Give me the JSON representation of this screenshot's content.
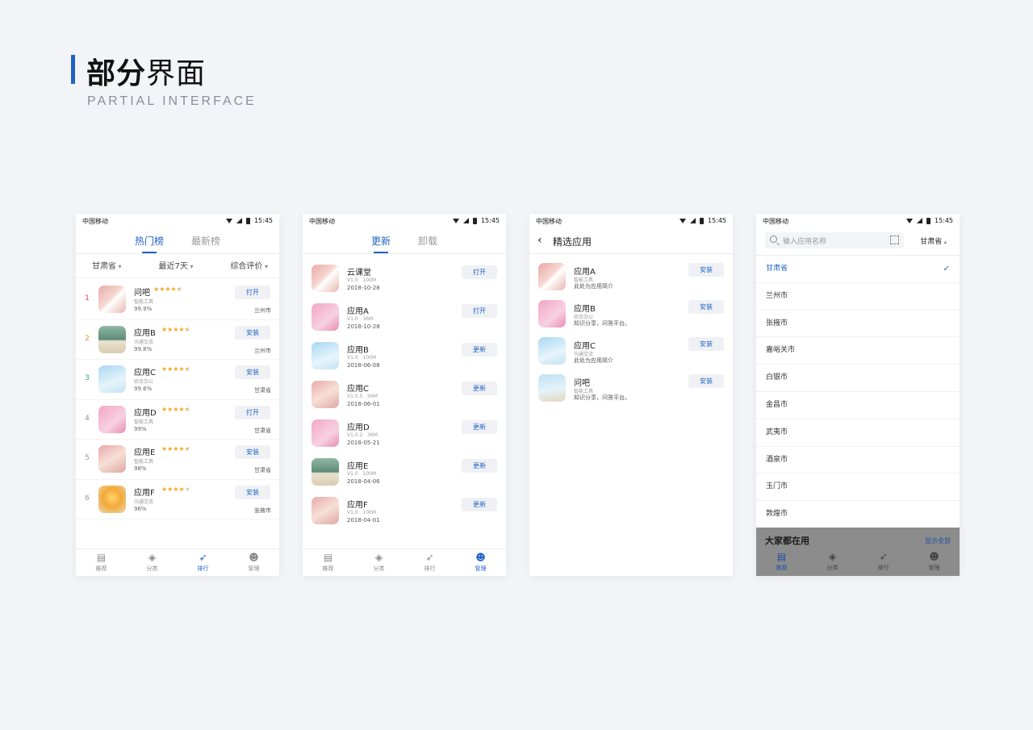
{
  "header": {
    "title_bold": "部分",
    "title_light": "界面",
    "subtitle": "PARTIAL INTERFACE",
    "accent": "#1f63c6"
  },
  "status": {
    "carrier": "中国移动",
    "time": "15:45"
  },
  "nav": [
    {
      "label": "推荐",
      "icon": "book-icon"
    },
    {
      "label": "分类",
      "icon": "layers-icon"
    },
    {
      "label": "排行",
      "icon": "rocket-icon"
    },
    {
      "label": "管理",
      "icon": "user-gear-icon"
    }
  ],
  "screen1": {
    "tabs": [
      "热门榜",
      "最新榜"
    ],
    "filters": [
      "甘肃省",
      "最近7天",
      "综合评价"
    ],
    "rows": [
      {
        "rank": "1",
        "rank_color": "#e0383e",
        "name": "问吧",
        "rating": 4.5,
        "category": "智能工具",
        "percent": "99.9%",
        "location": "兰州市",
        "button": "打开"
      },
      {
        "rank": "2",
        "rank_color": "#f08a24",
        "name": "应用B",
        "rating": 4.5,
        "category": "沟通交流",
        "percent": "99.8%",
        "location": "兰州市",
        "button": "安装"
      },
      {
        "rank": "3",
        "rank_color": "#2ea44f",
        "name": "应用C",
        "rating": 4.5,
        "category": "综合办公",
        "percent": "99.6%",
        "location": "甘肃省",
        "button": "安装"
      },
      {
        "rank": "4",
        "rank_color": "#999999",
        "name": "应用D",
        "rating": 4.5,
        "category": "智能工具",
        "percent": "99%",
        "location": "甘肃省",
        "button": "打开"
      },
      {
        "rank": "5",
        "rank_color": "#999999",
        "name": "应用E",
        "rating": 4.5,
        "category": "智能工具",
        "percent": "98%",
        "location": "甘肃省",
        "button": "安装"
      },
      {
        "rank": "6",
        "rank_color": "#999999",
        "name": "应用F",
        "rating": 4,
        "category": "沟通交流",
        "percent": "96%",
        "location": "张掖市",
        "button": "安装"
      }
    ]
  },
  "screen2": {
    "tabs": [
      "更新",
      "卸载"
    ],
    "rows": [
      {
        "name": "云课堂",
        "version": "V1.0",
        "size": "100M",
        "date": "2018-10-28",
        "button": "打开"
      },
      {
        "name": "应用A",
        "version": "V1.0",
        "size": "36M",
        "date": "2018-10-28",
        "button": "打开"
      },
      {
        "name": "应用B",
        "version": "V1.0",
        "size": "100M",
        "date": "2018-06-08",
        "button": "更新"
      },
      {
        "name": "应用C",
        "version": "V1.0.5",
        "size": "56M",
        "date": "2018-06-01",
        "button": "更新"
      },
      {
        "name": "应用D",
        "version": "V1.0.2",
        "size": "36M",
        "date": "2018-05-21",
        "button": "更新"
      },
      {
        "name": "应用E",
        "version": "V1.0",
        "size": "100M",
        "date": "2018-04-06",
        "button": "更新"
      },
      {
        "name": "应用F",
        "version": "V1.0",
        "size": "100M",
        "date": "2018-04-01",
        "button": "更新"
      }
    ]
  },
  "screen3": {
    "title": "精选应用",
    "rows": [
      {
        "name": "应用A",
        "category": "智能工具",
        "desc": "此处为应用简介",
        "button": "安装"
      },
      {
        "name": "应用B",
        "category": "综合办公",
        "desc": "知识分享，问答平台。",
        "button": "安装"
      },
      {
        "name": "应用C",
        "category": "沟通交流",
        "desc": "此处为应用简介",
        "button": "安装"
      },
      {
        "name": "问吧",
        "category": "智能工具",
        "desc": "知识分享，问答平台。",
        "button": "安装"
      }
    ]
  },
  "screen4": {
    "search_placeholder": "输入应用名称",
    "province": "甘肃省",
    "cities": [
      "甘肃省",
      "兰州市",
      "张掖市",
      "嘉峪关市",
      "白银市",
      "金昌市",
      "武夷市",
      "酒泉市",
      "玉门市",
      "敦煌市"
    ],
    "selected_index": 0,
    "popular_title": "大家都在用",
    "show_all": "显示全部"
  }
}
